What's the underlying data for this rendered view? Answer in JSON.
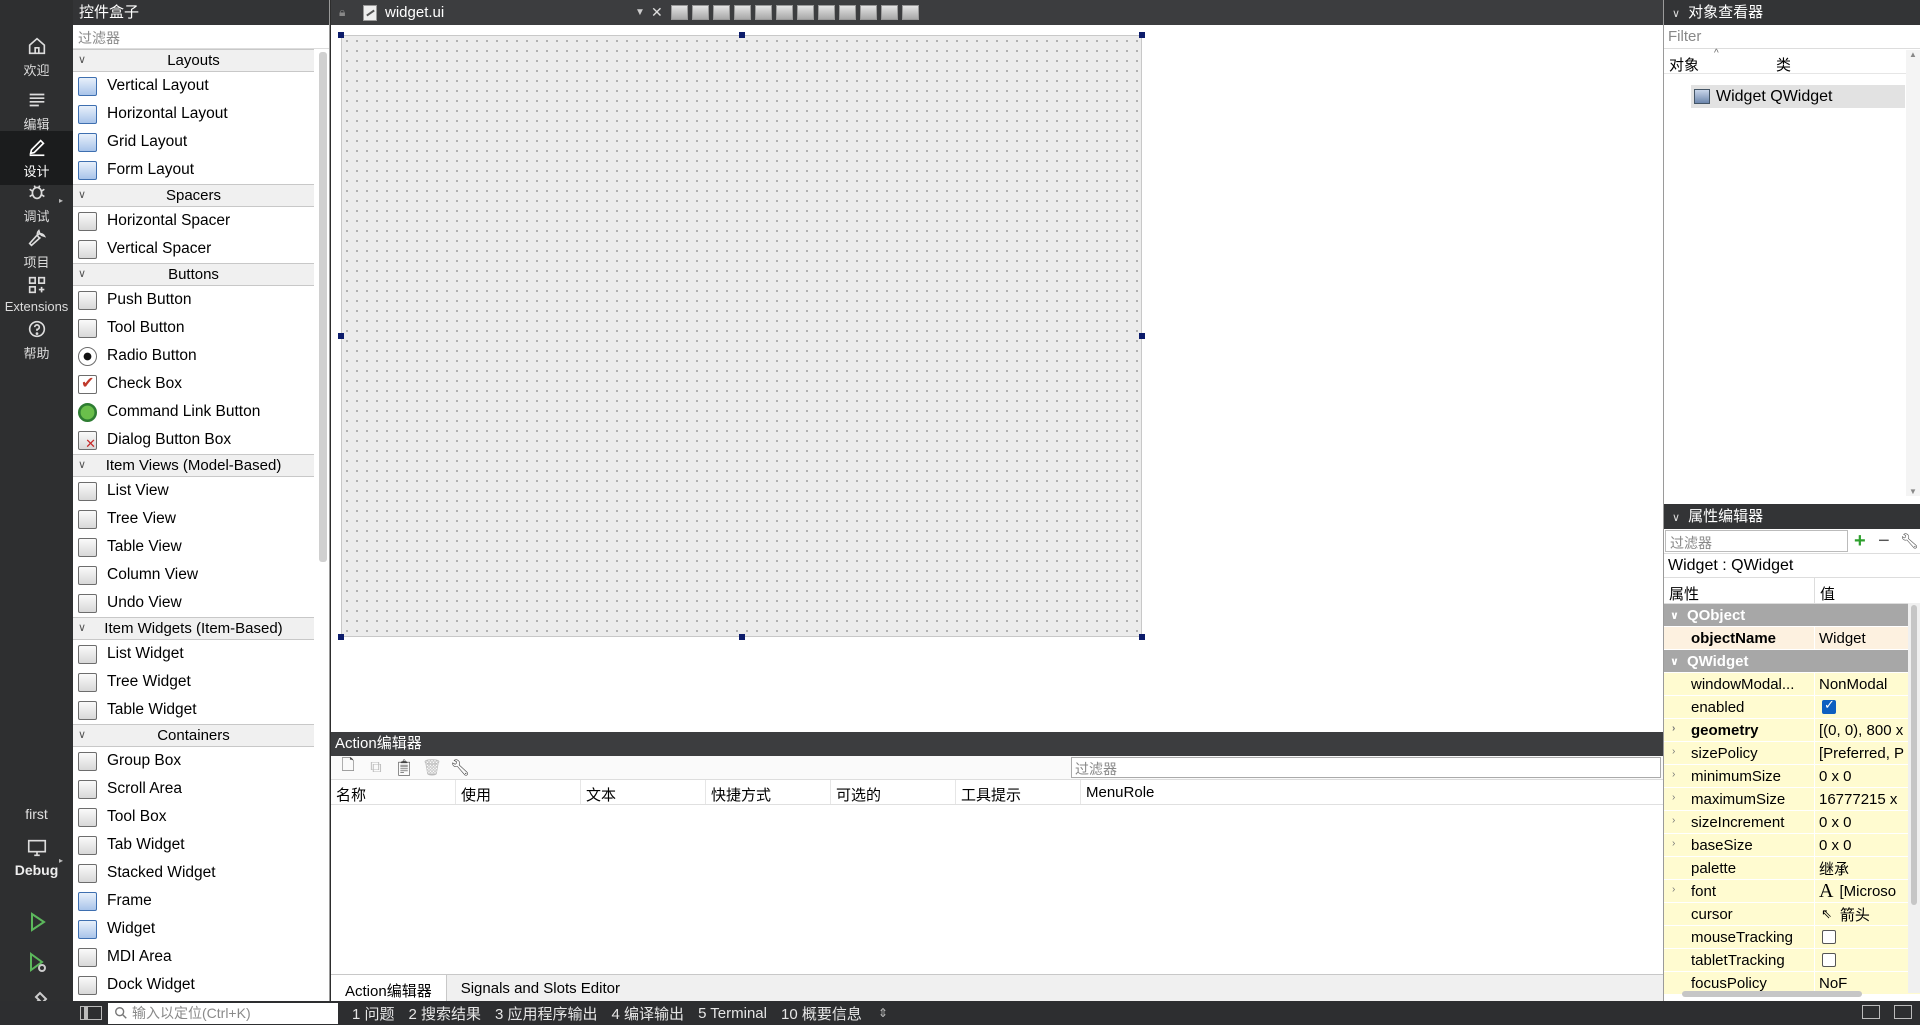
{
  "modebar": {
    "modes": [
      {
        "label": "欢迎",
        "icon": "home-icon"
      },
      {
        "label": "编辑",
        "icon": "edit-lines-icon"
      },
      {
        "label": "设计",
        "icon": "pen-icon"
      },
      {
        "label": "调试",
        "icon": "bug-icon"
      },
      {
        "label": "项目",
        "icon": "wrench-icon"
      },
      {
        "label": "Extensions",
        "icon": "extensions-icon"
      },
      {
        "label": "帮助",
        "icon": "help-icon"
      }
    ],
    "kit_project": "first",
    "kit_build": "Debug"
  },
  "widget_box": {
    "title": "控件盒子",
    "filter_placeholder": "过滤器",
    "categories": [
      {
        "name": "Layouts",
        "items": [
          "Vertical Layout",
          "Horizontal Layout",
          "Grid Layout",
          "Form Layout"
        ]
      },
      {
        "name": "Spacers",
        "items": [
          "Horizontal Spacer",
          "Vertical Spacer"
        ]
      },
      {
        "name": "Buttons",
        "items": [
          "Push Button",
          "Tool Button",
          "Radio Button",
          "Check Box",
          "Command Link Button",
          "Dialog Button Box"
        ]
      },
      {
        "name": "Item Views (Model-Based)",
        "items": [
          "List View",
          "Tree View",
          "Table View",
          "Column View",
          "Undo View"
        ]
      },
      {
        "name": "Item Widgets (Item-Based)",
        "items": [
          "List Widget",
          "Tree Widget",
          "Table Widget"
        ]
      },
      {
        "name": "Containers",
        "items": [
          "Group Box",
          "Scroll Area",
          "Tool Box",
          "Tab Widget",
          "Stacked Widget",
          "Frame",
          "Widget",
          "MDI Area",
          "Dock Widget"
        ]
      }
    ]
  },
  "editor": {
    "file_name": "widget.ui"
  },
  "action_editor": {
    "title": "Action编辑器",
    "filter_placeholder": "过滤器",
    "columns": [
      "名称",
      "使用",
      "文本",
      "快捷方式",
      "可选的",
      "工具提示",
      "MenuRole"
    ],
    "tabs": [
      "Action编辑器",
      "Signals and Slots Editor"
    ]
  },
  "object_inspector": {
    "title": "对象查看器",
    "filter_placeholder": "Filter",
    "col_object": "对象",
    "col_class": "类",
    "row_object": "Widget",
    "row_class": "QWidget"
  },
  "property_editor": {
    "title": "属性编辑器",
    "filter_placeholder": "过滤器",
    "class_label": "Widget : QWidget",
    "col_property": "属性",
    "col_value": "值",
    "group_qobject": "QObject",
    "group_qwidget": "QWidget",
    "rows": [
      {
        "name": "objectName",
        "value": "Widget"
      },
      {
        "name": "windowModal...",
        "value": "NonModal"
      },
      {
        "name": "enabled",
        "value": ""
      },
      {
        "name": "geometry",
        "value": "[(0, 0), 800 x"
      },
      {
        "name": "sizePolicy",
        "value": "[Preferred, P"
      },
      {
        "name": "minimumSize",
        "value": "0 x 0"
      },
      {
        "name": "maximumSize",
        "value": "16777215 x"
      },
      {
        "name": "sizeIncrement",
        "value": "0 x 0"
      },
      {
        "name": "baseSize",
        "value": "0 x 0"
      },
      {
        "name": "palette",
        "value": "继承"
      },
      {
        "name": "font",
        "value": "[Microso"
      },
      {
        "name": "cursor",
        "value": "箭头"
      },
      {
        "name": "mouseTracking",
        "value": ""
      },
      {
        "name": "tabletTracking",
        "value": ""
      },
      {
        "name": "focusPolicy",
        "value": "NoF"
      }
    ]
  },
  "statusbar": {
    "locator_placeholder": "输入以定位(Ctrl+K)",
    "tabs": [
      "1 问题",
      "2 搜索结果",
      "3 应用程序输出",
      "4 编译输出",
      "5 Terminal",
      "10 概要信息"
    ]
  }
}
